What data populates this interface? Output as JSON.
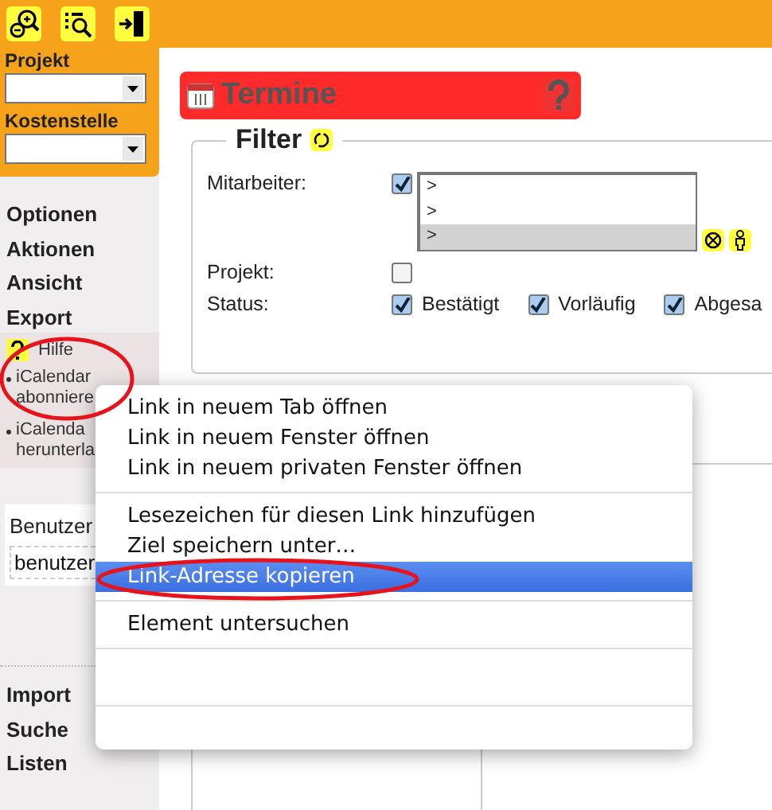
{
  "sidebar": {
    "selects": [
      {
        "label": "Projekt"
      },
      {
        "label": "Kostenstelle"
      }
    ],
    "nav": [
      "Optionen",
      "Aktionen",
      "Ansicht",
      "Export"
    ],
    "help": "Hilfe",
    "links": [
      "iCalendar abonniere",
      "iCalenda herunterla"
    ],
    "user": {
      "label": "Benutzer",
      "value": "benutzer"
    },
    "nav2": [
      "Import",
      "Suche",
      "Listen"
    ]
  },
  "page": {
    "title": "Termine",
    "filter": {
      "title": "Filter",
      "rows": [
        {
          "kind": "list",
          "label": "Mitarbeiter:",
          "checked": true,
          "items": [
            {
              "text": ">",
              "selected": false
            },
            {
              "text": ">",
              "selected": false
            },
            {
              "text": ">",
              "selected": true
            }
          ]
        },
        {
          "kind": "checkbox",
          "label": "Projekt:",
          "checked": false
        },
        {
          "kind": "options",
          "label": "Status:",
          "options": [
            {
              "label": "Bestätigt",
              "checked": true
            },
            {
              "label": "Vorläufig",
              "checked": true
            },
            {
              "label": "Abgesa",
              "checked": true
            }
          ]
        }
      ]
    }
  },
  "context_menu": {
    "groups": [
      [
        {
          "label": "Link in neuem Tab öffnen",
          "selected": false
        },
        {
          "label": "Link in neuem Fenster öffnen",
          "selected": false
        },
        {
          "label": "Link in neuem privaten Fenster öffnen",
          "selected": false
        }
      ],
      [
        {
          "label": "Lesezeichen für diesen Link hinzufügen",
          "selected": false
        },
        {
          "label": "Ziel speichern unter…",
          "selected": false
        },
        {
          "label": "Link-Adresse kopieren",
          "selected": true
        }
      ],
      [
        {
          "label": "Element untersuchen",
          "selected": false
        }
      ]
    ]
  }
}
